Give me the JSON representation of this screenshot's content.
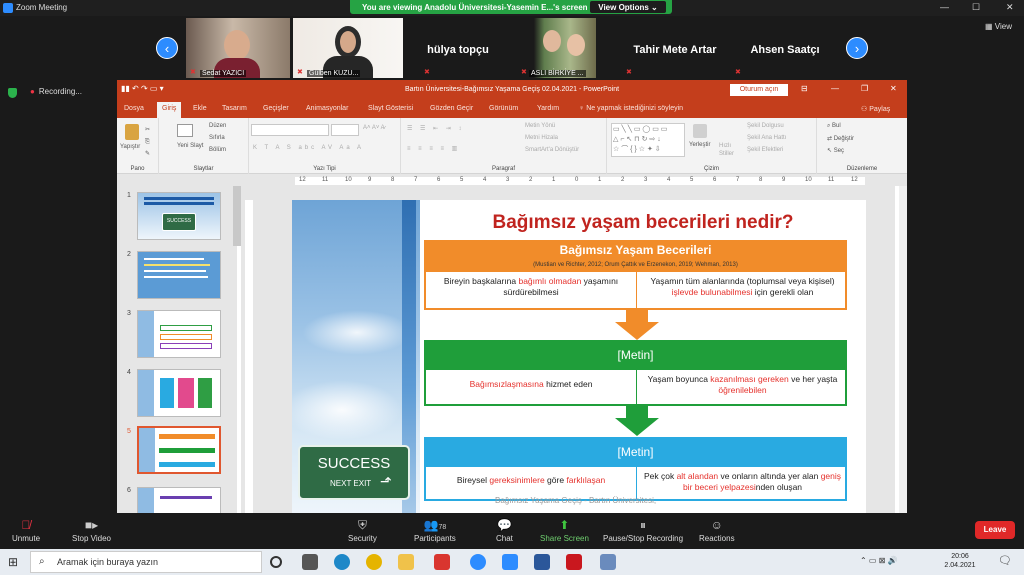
{
  "zoom": {
    "title": "Zoom Meeting",
    "viewing": "You are viewing Anadolu Üniversitesi-Yasemin E...'s screen",
    "view_options": "View Options ⌄",
    "view_label": "View",
    "participants": [
      {
        "name": "Sedat YAZICI",
        "type": "video"
      },
      {
        "name": "Gülben KUZU...",
        "type": "video"
      },
      {
        "name": "hülya topçu",
        "type": "name"
      },
      {
        "name": "ASLI BİRKİYE ...",
        "type": "video"
      },
      {
        "name": "Tahir Mete Artar",
        "type": "name"
      },
      {
        "name": "Ahsen Saatçı",
        "type": "name"
      }
    ],
    "recording": "Recording...",
    "toolbar": {
      "unmute": "Unmute",
      "stop_video": "Stop Video",
      "security": "Security",
      "participants": "Participants",
      "participants_count": "78",
      "chat": "Chat",
      "share_screen": "Share Screen",
      "pause_recording": "Pause/Stop Recording",
      "reactions": "Reactions",
      "leave": "Leave"
    }
  },
  "ppt": {
    "title": "Bartın Üniversitesi-Bağımsız Yaşama Geçiş 02.04.2021  -  PowerPoint",
    "login": "Oturum açın",
    "tabs": [
      "Dosya",
      "Giriş",
      "Ekle",
      "Tasarım",
      "Geçişler",
      "Animasyonlar",
      "Slayt Gösterisi",
      "Gözden Geçir",
      "Görünüm",
      "Yardım"
    ],
    "tell_me": "Ne yapmak istediğinizi söyleyin",
    "share": "Paylaş",
    "groups": {
      "pano": "Pano",
      "slaytlar": "Slaytlar",
      "yazi_tipi": "Yazı Tipi",
      "paragraf": "Paragraf",
      "cizim": "Çizim",
      "duzenleme": "Düzenleme"
    },
    "ribbon": {
      "yapistir": "Yapıştır",
      "yeni_slayt": "Yeni Slayt",
      "duzen": "Düzen",
      "sifirla": "Sıfırla",
      "bolum": "Bölüm",
      "metin_yonu": "Metin Yönü",
      "metni_hizala": "Metni Hizala",
      "smartart": "SmartArt'a Dönüştür",
      "yerlestir": "Yerleştir",
      "hizli_stiller": "Hızlı Stiller",
      "sekil_dolgusu": "Şekil Dolgusu",
      "sekil_ana_hatti": "Şekil Ana Hattı",
      "sekil_efektleri": "Şekil Efektleri",
      "bul": "Bul",
      "degistir": "Değiştir",
      "sec": "Seç"
    },
    "ruler_numbers": [
      "12",
      "11",
      "10",
      "9",
      "8",
      "7",
      "6",
      "5",
      "4",
      "3",
      "2",
      "1",
      "0",
      "1",
      "2",
      "3",
      "4",
      "5",
      "6",
      "7",
      "8",
      "9",
      "10",
      "11",
      "12"
    ],
    "thumb_numbers": [
      "1",
      "2",
      "3",
      "4",
      "5",
      "6"
    ],
    "thumb_titles": {
      "1": "SUCCESS"
    }
  },
  "slide": {
    "heading": "Bağımsız yaşam becerileri nedir?",
    "box1_title": "Bağımsız Yaşam Becerileri",
    "box1_citation": "(Mustian ve Richter, 2012; Orum Çattık ve Erzenekon, 2019; Wehman, 2013)",
    "row1_left_a": "Bireyin başkalarına ",
    "row1_left_red": "bağımlı olmadan",
    "row1_left_b": " yaşamını sürdürebilmesi",
    "row1_right_a": "Yaşamın tüm alanlarında (toplumsal veya kişisel) ",
    "row1_right_red": "işlevde bulunabilmesi",
    "row1_right_b": " için gerekli olan",
    "box2_title": "[Metin]",
    "row2_left_red": "Bağımsızlaşmasına",
    "row2_left_b": " hizmet eden",
    "row2_right_a": "Yaşam boyunca ",
    "row2_right_red": "kazanılması gereken",
    "row2_right_b": " ve her yaşta ",
    "row2_right_red2": "öğrenilebilen",
    "box3_title": "[Metin]",
    "row3_left_a": "Bireysel ",
    "row3_left_red": "gereksinimlere",
    "row3_left_b": " göre ",
    "row3_left_red2": "farklılaşan",
    "row3_right_a": "Pek çok ",
    "row3_right_red": "alt alandan",
    "row3_right_b": " ve onların altında yer alan ",
    "row3_right_red2": "geniş bir beceri yelpazesi",
    "row3_right_c": "nden oluşan",
    "sign_main": "SUCCESS",
    "sign_sub": "NEXT EXIT",
    "footer": "Bağımsız Yaşama Geçiş - Bartın Üniversitesi,"
  },
  "taskbar": {
    "search": "Aramak için buraya yazın",
    "time": "20:06",
    "date": "2.04.2021"
  },
  "colors": {
    "ppt_red": "#c43e1c",
    "orange": "#f18c2a",
    "green": "#1f9e3a",
    "blue": "#29aae1",
    "heading_red": "#c0241f"
  }
}
